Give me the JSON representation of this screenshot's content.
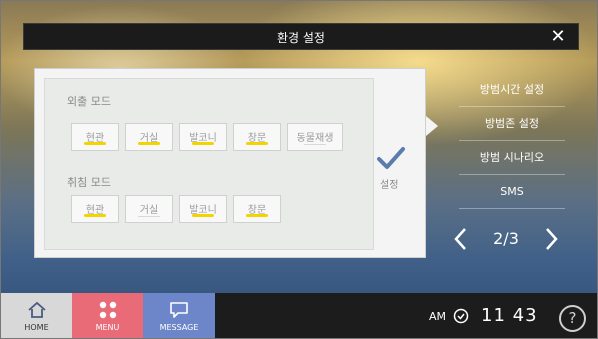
{
  "header": {
    "title": "환경 설정",
    "close_glyph": "✕"
  },
  "panel": {
    "away_mode": {
      "label": "외출 모드",
      "buttons": [
        {
          "label": "현관",
          "active": true
        },
        {
          "label": "거실",
          "active": true
        },
        {
          "label": "발코니",
          "active": true
        },
        {
          "label": "창문",
          "active": true
        },
        {
          "label": "동물재생",
          "active": false
        }
      ]
    },
    "sleep_mode": {
      "label": "취침 모드",
      "buttons": [
        {
          "label": "현관",
          "active": true
        },
        {
          "label": "거실",
          "active": false
        },
        {
          "label": "발코니",
          "active": true
        },
        {
          "label": "창문",
          "active": true
        }
      ]
    },
    "set_label": "설정"
  },
  "side_menu": {
    "items": [
      "방범시간 설정",
      "방범존 설정",
      "방범 시나리오",
      "SMS"
    ],
    "pager": "2/3"
  },
  "bottom_nav": {
    "home": "HOME",
    "menu": "MENU",
    "message": "MESSAGE"
  },
  "clock": {
    "ampm": "AM",
    "time": "11 43"
  },
  "help_glyph": "?",
  "colors": {
    "accent_yellow": "#f2d400",
    "menu_pink": "#ea6b78",
    "message_blue": "#6c86c9",
    "home_gray": "#d8d8d8"
  }
}
